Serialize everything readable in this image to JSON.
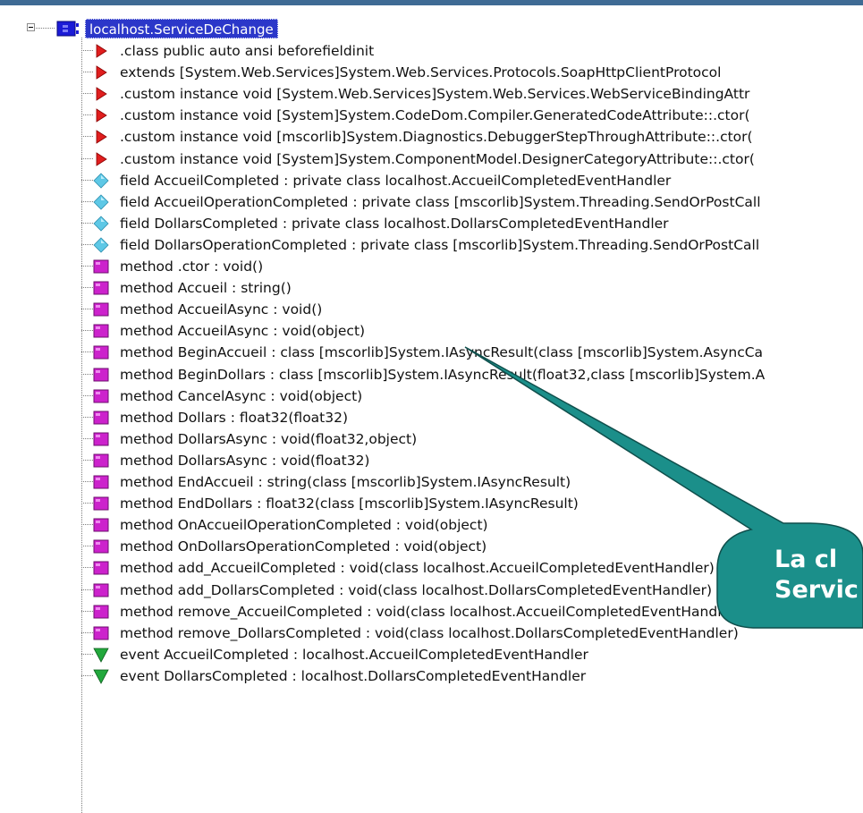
{
  "root": {
    "label": "localhost.ServiceDeChange",
    "icon": "class-icon"
  },
  "members": [
    {
      "kind": "directive",
      "icon": "red-triangle-icon",
      "label": ".class public auto ansi beforefieldinit"
    },
    {
      "kind": "directive",
      "icon": "red-triangle-icon",
      "label": "extends [System.Web.Services]System.Web.Services.Protocols.SoapHttpClientProtocol"
    },
    {
      "kind": "directive",
      "icon": "red-triangle-icon",
      "label": ".custom instance void [System.Web.Services]System.Web.Services.WebServiceBindingAttr"
    },
    {
      "kind": "directive",
      "icon": "red-triangle-icon",
      "label": ".custom instance void [System]System.CodeDom.Compiler.GeneratedCodeAttribute::.ctor("
    },
    {
      "kind": "directive",
      "icon": "red-triangle-icon",
      "label": ".custom instance void [mscorlib]System.Diagnostics.DebuggerStepThroughAttribute::.ctor("
    },
    {
      "kind": "directive",
      "icon": "red-triangle-icon",
      "label": ".custom instance void [System]System.ComponentModel.DesignerCategoryAttribute::.ctor("
    },
    {
      "kind": "field",
      "icon": "cyan-diamond-icon",
      "label": "field AccueilCompleted : private class localhost.AccueilCompletedEventHandler"
    },
    {
      "kind": "field",
      "icon": "cyan-diamond-icon",
      "label": "field AccueilOperationCompleted : private class [mscorlib]System.Threading.SendOrPostCall"
    },
    {
      "kind": "field",
      "icon": "cyan-diamond-icon",
      "label": "field DollarsCompleted : private class localhost.DollarsCompletedEventHandler"
    },
    {
      "kind": "field",
      "icon": "cyan-diamond-icon",
      "label": "field DollarsOperationCompleted : private class [mscorlib]System.Threading.SendOrPostCall"
    },
    {
      "kind": "method",
      "icon": "magenta-square-icon",
      "label": "method .ctor : void()"
    },
    {
      "kind": "method",
      "icon": "magenta-square-icon",
      "label": "method Accueil : string()"
    },
    {
      "kind": "method",
      "icon": "magenta-square-icon",
      "label": "method AccueilAsync : void()"
    },
    {
      "kind": "method",
      "icon": "magenta-square-icon",
      "label": "method AccueilAsync : void(object)"
    },
    {
      "kind": "method",
      "icon": "magenta-square-icon",
      "label": "method BeginAccueil : class [mscorlib]System.IAsyncResult(class [mscorlib]System.AsyncCa"
    },
    {
      "kind": "method",
      "icon": "magenta-square-icon",
      "label": "method BeginDollars : class [mscorlib]System.IAsyncResult(float32,class [mscorlib]System.A"
    },
    {
      "kind": "method",
      "icon": "magenta-square-icon",
      "label": "method CancelAsync : void(object)"
    },
    {
      "kind": "method",
      "icon": "magenta-square-icon",
      "label": "method Dollars : float32(float32)"
    },
    {
      "kind": "method",
      "icon": "magenta-square-icon",
      "label": "method DollarsAsync : void(float32,object)"
    },
    {
      "kind": "method",
      "icon": "magenta-square-icon",
      "label": "method DollarsAsync : void(float32)"
    },
    {
      "kind": "method",
      "icon": "magenta-square-icon",
      "label": "method EndAccueil : string(class [mscorlib]System.IAsyncResult)"
    },
    {
      "kind": "method",
      "icon": "magenta-square-icon",
      "label": "method EndDollars : float32(class [mscorlib]System.IAsyncResult)"
    },
    {
      "kind": "method",
      "icon": "magenta-square-icon",
      "label": "method OnAccueilOperationCompleted : void(object)"
    },
    {
      "kind": "method",
      "icon": "magenta-square-icon",
      "label": "method OnDollarsOperationCompleted : void(object)"
    },
    {
      "kind": "method",
      "icon": "magenta-square-icon",
      "label": "method add_AccueilCompleted : void(class localhost.AccueilCompletedEventHandler)"
    },
    {
      "kind": "method",
      "icon": "magenta-square-icon",
      "label": "method add_DollarsCompleted : void(class localhost.DollarsCompletedEventHandler)"
    },
    {
      "kind": "method",
      "icon": "magenta-square-icon",
      "label": "method remove_AccueilCompleted : void(class localhost.AccueilCompletedEventHandler)"
    },
    {
      "kind": "method",
      "icon": "magenta-square-icon",
      "label": "method remove_DollarsCompleted : void(class localhost.DollarsCompletedEventHandler)"
    },
    {
      "kind": "event",
      "icon": "green-triangle-down-icon",
      "label": "event AccueilCompleted : localhost.AccueilCompletedEventHandler"
    },
    {
      "kind": "event",
      "icon": "green-triangle-down-icon",
      "label": "event DollarsCompleted : localhost.DollarsCompletedEventHandler"
    }
  ],
  "callout": {
    "line1": "La cl",
    "line2": "Servic"
  },
  "colors": {
    "selection": "#2b37c9",
    "directive": "#e01e1e",
    "field": "#5ec8e6",
    "method": "#cc22cc",
    "event": "#22a83c",
    "callout_fill": "#1b8f8a"
  }
}
